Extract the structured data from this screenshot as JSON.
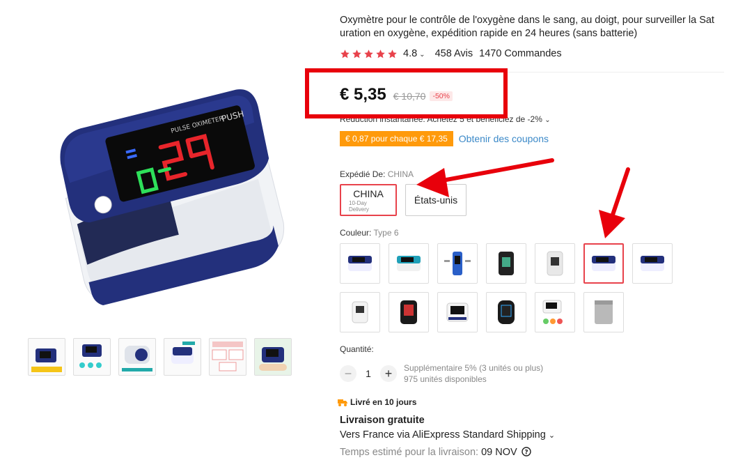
{
  "product": {
    "title": "Oxymètre pour le contrôle de l'oxygène dans le sang, au doigt, pour surveiller la Sat uration en oxygène, expédition rapide en 24 heures (sans batterie)",
    "rating": "4.8",
    "reviews": "458 Avis",
    "orders": "1470 Commandes",
    "price": "€ 5,35",
    "old_price": "€ 10,70",
    "discount": "-50%",
    "reduction_text": "Réduction instantanée: Achetez 5 et bénéficiez de -2%",
    "coupon_badge": "€ 0,87 pour chaque € 17,35",
    "coupon_link": "Obtenir des coupons",
    "screen_text": "PUSH",
    "screen_label": "PULSE OXIMETER"
  },
  "shipping": {
    "label": "Expédié De:",
    "selected": "CHINA",
    "options": [
      {
        "label": "CHINA",
        "sub": "10-Day Delivery"
      },
      {
        "label": "États-unis"
      }
    ]
  },
  "color": {
    "label": "Couleur:",
    "selected": "Type 6"
  },
  "quantity": {
    "label": "Quantité:",
    "value": "1",
    "extra": "Supplémentaire 5% (3 unités ou plus)",
    "available": "975 unités disponibles"
  },
  "delivery": {
    "badge": "Livré en 10 jours",
    "free_shipping": "Livraison gratuite",
    "via": "Vers France via AliExpress Standard Shipping",
    "eta_label": "Temps estimé pour la livraison:",
    "eta_value": "09 NOV"
  },
  "icons": [
    "star-icon",
    "chevron-down-icon",
    "truck-icon",
    "help-icon",
    "minus-icon",
    "plus-icon",
    "arrow-icon"
  ],
  "colors": {
    "accent": "#e8424b",
    "coupon": "#ff9a0b",
    "link": "#3b89c8",
    "device_blue": "#23307c"
  }
}
